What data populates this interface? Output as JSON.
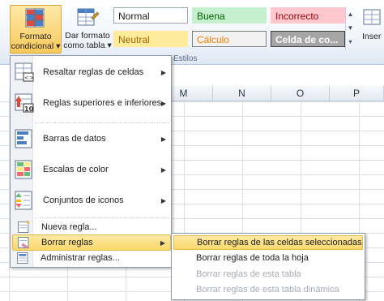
{
  "ribbon": {
    "cond_format": {
      "label_line1": "Formato",
      "label_line2": "condicional",
      "arrow": "▾"
    },
    "table_format": {
      "label_line1": "Dar formato",
      "label_line2": "como tabla",
      "arrow": "▾"
    },
    "styles": [
      {
        "label": "Normal",
        "bg": "#ffffff",
        "color": "#1e1e1e",
        "border": "#9aa6b8"
      },
      {
        "label": "Buena",
        "bg": "#c6efce",
        "color": "#006100",
        "border": "#c6efce"
      },
      {
        "label": "Incorrecto",
        "bg": "#ffc7ce",
        "color": "#9c0006",
        "border": "#ffc7ce"
      },
      {
        "label": "Neutral",
        "bg": "#ffeb9c",
        "color": "#9c6500",
        "border": "#ffeb9c"
      },
      {
        "label": "Cálculo",
        "bg": "#f2f2f2",
        "color": "#fa7d00",
        "border": "#7f7f7f"
      },
      {
        "label": "Celda de co...",
        "bg": "#a5a5a5",
        "color": "#ffffff",
        "border": "#3f3f3f"
      }
    ],
    "styles_group_label": "Estilos",
    "insert_label": "Inser"
  },
  "columns": [
    "M",
    "N",
    "O",
    "P"
  ],
  "menu": {
    "items": [
      {
        "label": "Resaltar reglas de celdas",
        "icon": "highlight-cells-rules-icon",
        "has_submenu": true
      },
      {
        "label": "Reglas superiores e inferiores",
        "icon": "top-bottom-rules-icon",
        "has_submenu": true
      },
      {
        "label": "Barras de datos",
        "icon": "data-bars-icon",
        "has_submenu": true
      },
      {
        "label": "Escalas de color",
        "icon": "color-scales-icon",
        "has_submenu": true
      },
      {
        "label": "Conjuntos de iconos",
        "icon": "icon-sets-icon",
        "has_submenu": true
      },
      {
        "label": "Nueva regla...",
        "icon": "new-rule-icon",
        "has_submenu": false
      },
      {
        "label": "Borrar reglas",
        "icon": "clear-rules-icon",
        "has_submenu": true
      },
      {
        "label": "Administrar reglas...",
        "icon": "manage-rules-icon",
        "has_submenu": false
      }
    ],
    "arrow": "▶"
  },
  "submenu": {
    "items": [
      {
        "label": "Borrar reglas de las celdas seleccionadas",
        "enabled": true
      },
      {
        "label": "Borrar reglas de toda la hoja",
        "enabled": true
      },
      {
        "label": "Borrar reglas de esta tabla",
        "enabled": false
      },
      {
        "label": "Borrar reglas de esta tabla dinámica",
        "enabled": false
      }
    ]
  }
}
